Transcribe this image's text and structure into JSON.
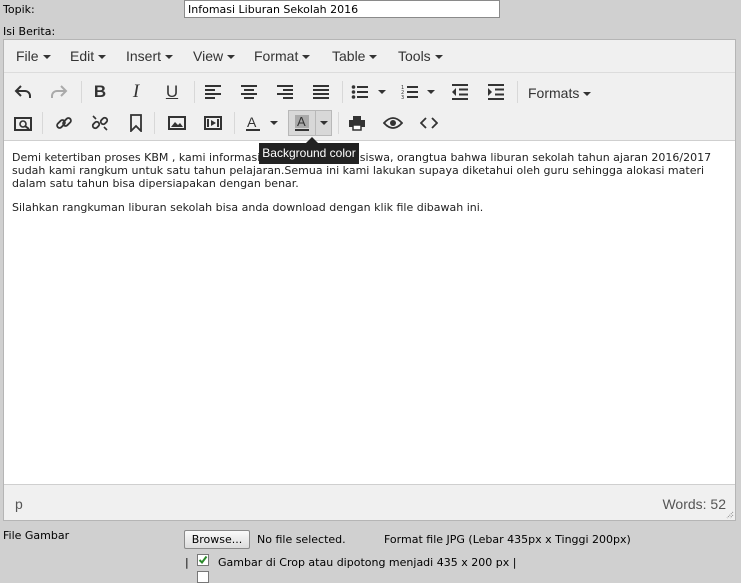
{
  "form": {
    "topik_label": "Topik:",
    "topik_value": "Infomasi Liburan Sekolah 2016",
    "isi_label": "Isi Berita:",
    "file_label": "File Gambar",
    "browse_label": "Browse...",
    "file_status": "No file selected.",
    "file_hint": "Format file JPG (Lebar 435px x Tinggi 200px)",
    "pipe_left": "|",
    "crop_label": "Gambar di Crop atau dipotong menjadi 435 x 200 px |",
    "crop_checked": true
  },
  "editor": {
    "menu": [
      {
        "label": "File"
      },
      {
        "label": "Edit"
      },
      {
        "label": "Insert"
      },
      {
        "label": "View"
      },
      {
        "label": "Format"
      },
      {
        "label": "Table"
      },
      {
        "label": "Tools"
      }
    ],
    "formats_label": "Formats",
    "tooltip": "Background color",
    "content": [
      "Demi ketertiban proses KBM , kami informasikan kepada guru, siswa, orangtua bahwa liburan sekolah tahun ajaran 2016/2017 sudah kami rangkum untuk satu tahun pelajaran.Semua ini kami lakukan supaya diketahui oleh guru sehingga alokasi materi dalam satu tahun bisa dipersiapakan dengan benar.",
      "Silahkan rangkuman liburan sekolah bisa anda download dengan klik file dibawah ini."
    ],
    "status_path": "p",
    "word_count": "Words: 52",
    "icons": [
      "undo-icon",
      "redo-icon",
      "bold-icon",
      "italic-icon",
      "underline-icon",
      "align-left-icon",
      "align-center-icon",
      "align-right-icon",
      "justify-icon",
      "bullet-list-icon",
      "numbered-list-icon",
      "outdent-icon",
      "indent-icon",
      "search-replace-icon",
      "link-icon",
      "unlink-icon",
      "bookmark-icon",
      "image-icon",
      "media-icon",
      "text-color-icon",
      "background-color-icon",
      "print-icon",
      "preview-icon",
      "code-icon"
    ]
  },
  "colors": {
    "page_bg": "#d0d0d0",
    "editor_bg": "#f0f0f0",
    "tooltip_bg": "#222222"
  }
}
